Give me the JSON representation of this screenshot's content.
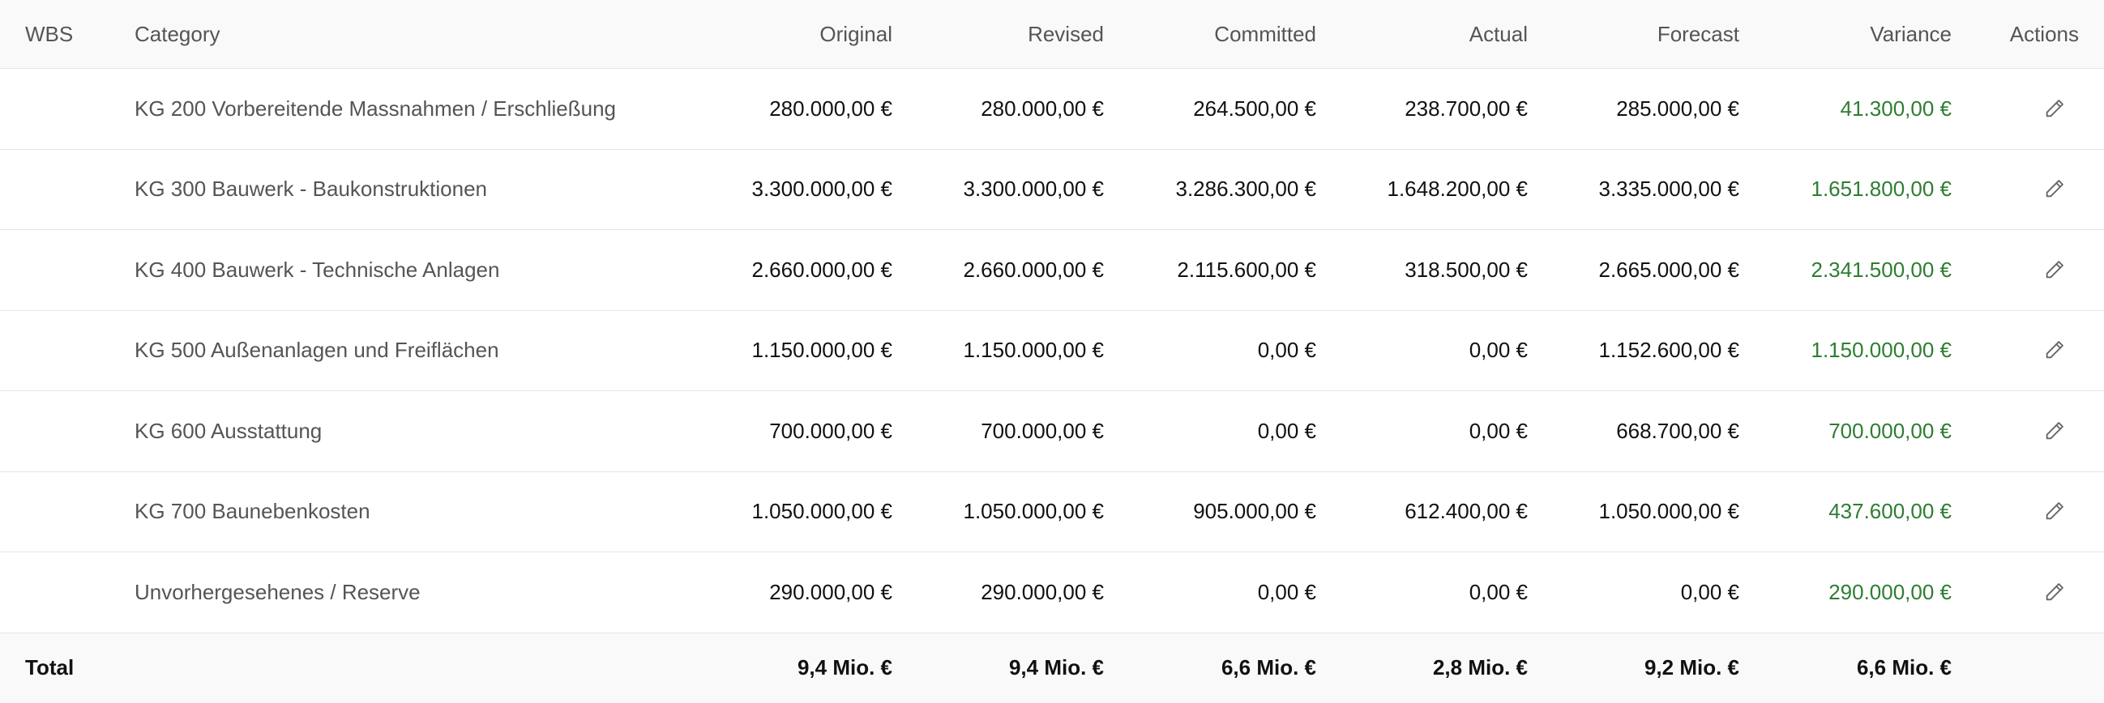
{
  "columns": {
    "wbs": "WBS",
    "category": "Category",
    "original": "Original",
    "revised": "Revised",
    "committed": "Committed",
    "actual": "Actual",
    "forecast": "Forecast",
    "variance": "Variance",
    "actions": "Actions"
  },
  "rows": [
    {
      "category": "KG 200 Vorbereitende Massnahmen / Erschließung",
      "original": "280.000,00 €",
      "revised": "280.000,00 €",
      "committed": "264.500,00 €",
      "actual": "238.700,00 €",
      "forecast": "285.000,00 €",
      "variance": "41.300,00 €",
      "action_icon": "pencil-icon"
    },
    {
      "category": "KG 300 Bauwerk - Baukonstruktionen",
      "original": "3.300.000,00 €",
      "revised": "3.300.000,00 €",
      "committed": "3.286.300,00 €",
      "actual": "1.648.200,00 €",
      "forecast": "3.335.000,00 €",
      "variance": "1.651.800,00 €",
      "action_icon": "pencil-icon"
    },
    {
      "category": "KG 400 Bauwerk - Technische Anlagen",
      "original": "2.660.000,00 €",
      "revised": "2.660.000,00 €",
      "committed": "2.115.600,00 €",
      "actual": "318.500,00 €",
      "forecast": "2.665.000,00 €",
      "variance": "2.341.500,00 €",
      "action_icon": "pencil-icon"
    },
    {
      "category": "KG 500 Außenanlagen und Freiflächen",
      "original": "1.150.000,00 €",
      "revised": "1.150.000,00 €",
      "committed": "0,00 €",
      "actual": "0,00 €",
      "forecast": "1.152.600,00 €",
      "variance": "1.150.000,00 €",
      "action_icon": "pencil-icon"
    },
    {
      "category": "KG 600 Ausstattung",
      "original": "700.000,00 €",
      "revised": "700.000,00 €",
      "committed": "0,00 €",
      "actual": "0,00 €",
      "forecast": "668.700,00 €",
      "variance": "700.000,00 €",
      "action_icon": "pencil-icon"
    },
    {
      "category": "KG 700 Baunebenkosten",
      "original": "1.050.000,00 €",
      "revised": "1.050.000,00 €",
      "committed": "905.000,00 €",
      "actual": "612.400,00 €",
      "forecast": "1.050.000,00 €",
      "variance": "437.600,00 €",
      "action_icon": "pencil-icon"
    },
    {
      "category": "Unvorhergesehenes / Reserve",
      "original": "290.000,00 €",
      "revised": "290.000,00 €",
      "committed": "0,00 €",
      "actual": "0,00 €",
      "forecast": "0,00 €",
      "variance": "290.000,00 €",
      "action_icon": "pencil-icon"
    }
  ],
  "total": {
    "label": "Total",
    "original": "9,4 Mio. €",
    "revised": "9,4 Mio. €",
    "committed": "6,6 Mio. €",
    "actual": "2,8 Mio. €",
    "forecast": "9,2 Mio. €",
    "variance": "6,6 Mio. €"
  },
  "colors": {
    "variance_positive": "#2e7d32",
    "header_background": "#f9f9f9",
    "row_divider": "#e6e6e6"
  }
}
